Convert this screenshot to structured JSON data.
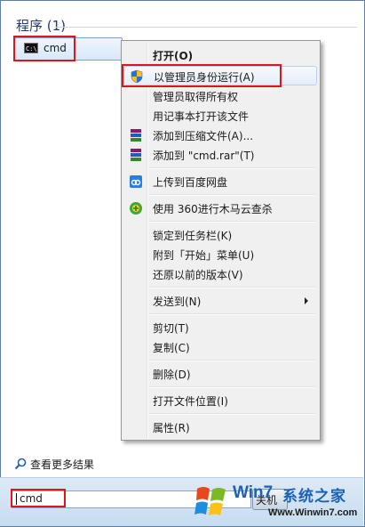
{
  "programs_header": "程序 (1)",
  "result": {
    "label": "cmd",
    "icon": "console-icon"
  },
  "context_menu": {
    "items": [
      {
        "label": "打开(O)",
        "bold": true,
        "icon": ""
      },
      {
        "label": "以管理员身份运行(A)",
        "icon": "uac-shield-icon",
        "highlighted": true
      },
      {
        "label": "管理员取得所有权",
        "icon": ""
      },
      {
        "label": "用记事本打开该文件",
        "icon": ""
      },
      {
        "label": "添加到压缩文件(A)...",
        "icon": "winrar-icon"
      },
      {
        "label": "添加到 \"cmd.rar\"(T)",
        "icon": "winrar-icon"
      },
      {
        "label": "上传到百度网盘",
        "icon": "baidu-cloud-icon"
      },
      {
        "label": "使用 360进行木马云查杀",
        "icon": "360-icon"
      },
      {
        "label": "锁定到任务栏(K)",
        "icon": ""
      },
      {
        "label": "附到「开始」菜单(U)",
        "icon": ""
      },
      {
        "label": "还原以前的版本(V)",
        "icon": ""
      },
      {
        "label": "发送到(N)",
        "icon": "",
        "submenu": true
      },
      {
        "label": "剪切(T)",
        "icon": ""
      },
      {
        "label": "复制(C)",
        "icon": ""
      },
      {
        "label": "删除(D)",
        "icon": ""
      },
      {
        "label": "打开文件位置(I)",
        "icon": ""
      },
      {
        "label": "属性(R)",
        "icon": ""
      }
    ]
  },
  "see_more": "查看更多结果",
  "search": {
    "value": "cmd"
  },
  "shutdown_label": "关机",
  "watermark": {
    "win_text": "Win7",
    "cn_text": "系统之家",
    "site": "Www.Winwin7.com"
  },
  "colors": {
    "highlight_box": "#e0141b",
    "accent": "#1b62b5"
  }
}
